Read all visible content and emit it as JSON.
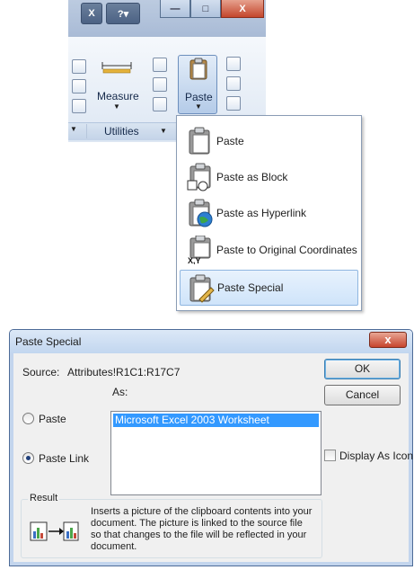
{
  "ribbon": {
    "quick_access_icon": "excel-x-icon",
    "help_icon": "help-icon",
    "window_controls": [
      "minimize-icon",
      "maximize-icon",
      "close-icon"
    ],
    "measure_label": "Measure",
    "utilities_label": "Utilities",
    "paste_label": "Paste"
  },
  "paste_menu": {
    "items": [
      {
        "label": "Paste",
        "icon": "clipboard-icon",
        "selected": false
      },
      {
        "label": "Paste as Block",
        "icon": "clipboard-block-icon",
        "selected": false
      },
      {
        "label": "Paste as Hyperlink",
        "icon": "clipboard-globe-icon",
        "selected": false
      },
      {
        "label": "Paste to Original Coordinates",
        "icon": "clipboard-xy-icon",
        "selected": false
      },
      {
        "label": "Paste Special",
        "icon": "clipboard-pencil-icon",
        "selected": true
      }
    ]
  },
  "dialog": {
    "title": "Paste Special",
    "close_label": "x",
    "source_label": "Source:",
    "source_value": "Attributes!R1C1:R17C7",
    "as_label": "As:",
    "paste_option": "Paste",
    "paste_link_option": "Paste Link",
    "selected_option": "Paste Link",
    "list_items": [
      "Microsoft Excel 2003 Worksheet"
    ],
    "ok_label": "OK",
    "cancel_label": "Cancel",
    "display_as_icon_label": "Display As Icon",
    "display_as_icon_checked": false,
    "result_label": "Result",
    "result_text_lines": [
      "Inserts a picture of the clipboard contents into your",
      "document.  The picture is linked to the source file",
      "so that changes to the file will be reflected in your",
      "document."
    ]
  },
  "colors": {
    "selection_blue": "#3399ff",
    "menu_highlight": "#cfe4fa",
    "ribbon_bg": "#dde7f3"
  }
}
